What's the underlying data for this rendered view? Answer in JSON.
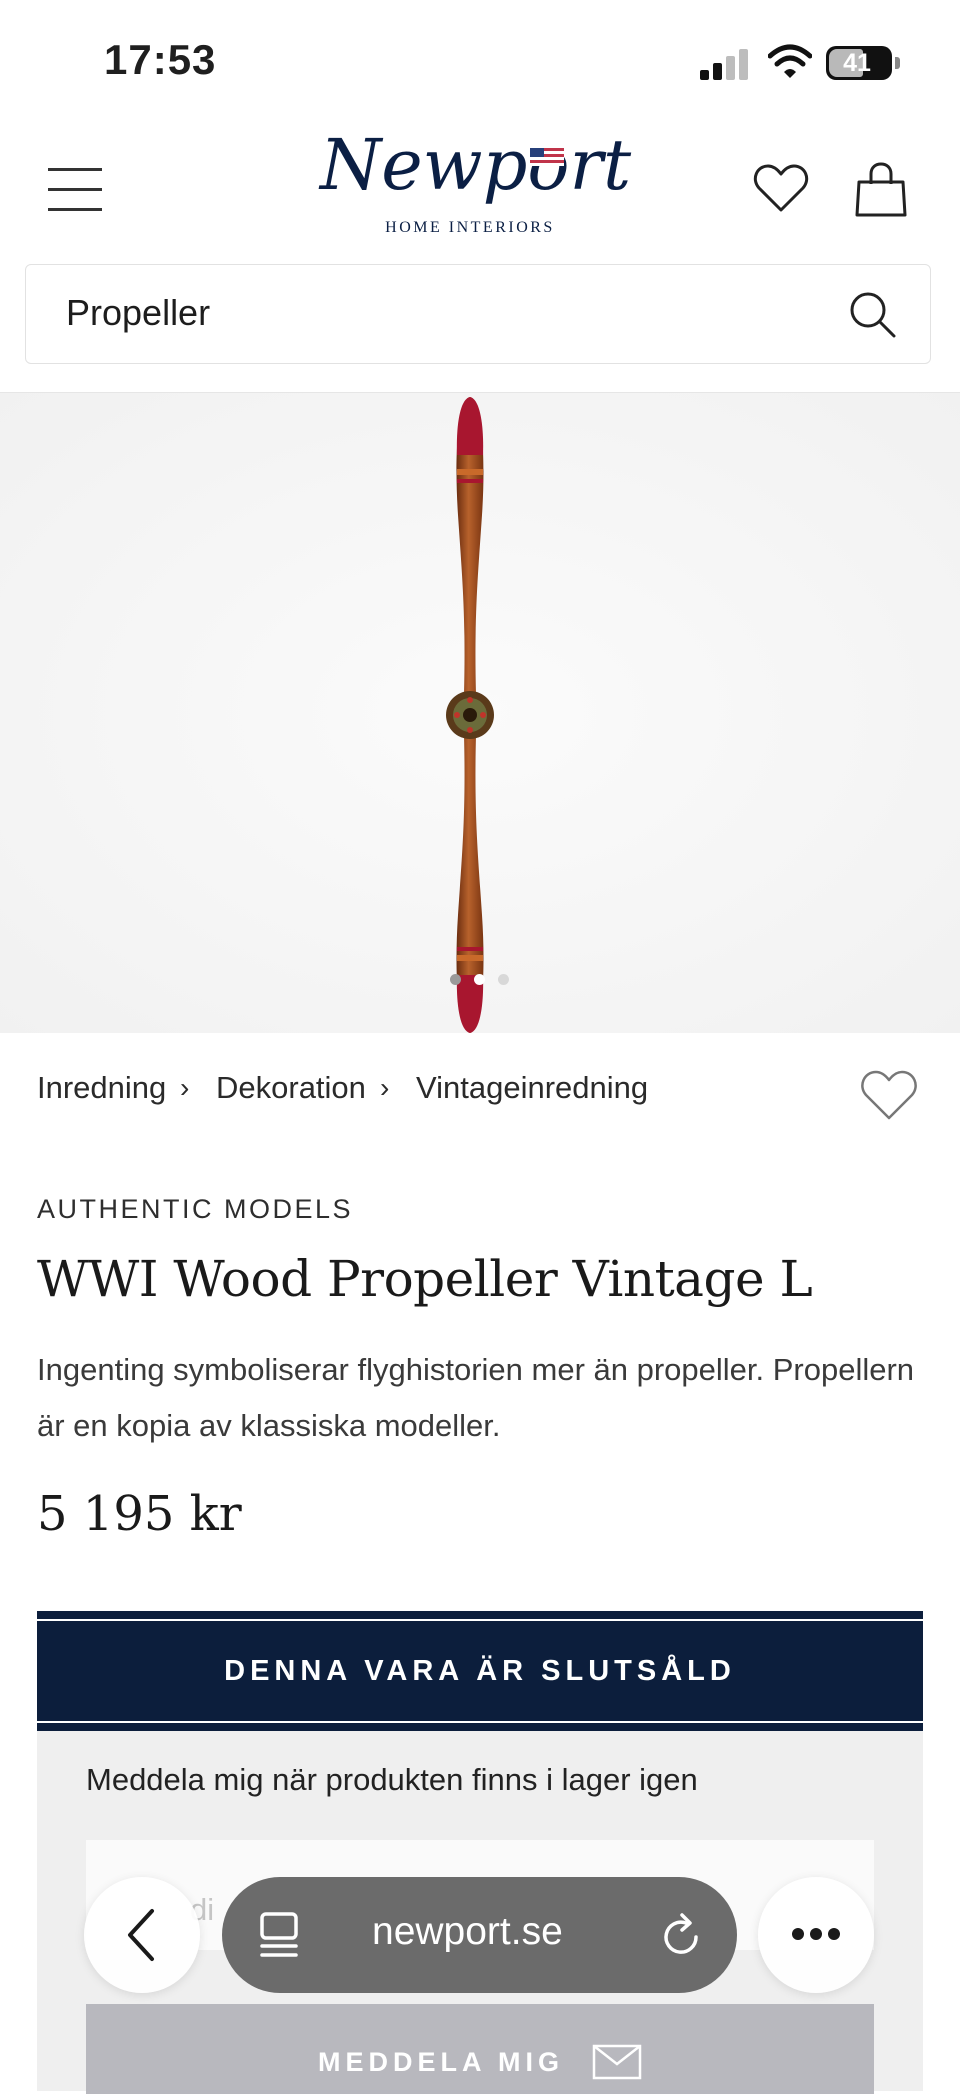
{
  "status_bar": {
    "time": "17:53",
    "battery": "41"
  },
  "header": {
    "logo_word": "Newport",
    "logo_sub": "HOME INTERIORS"
  },
  "search": {
    "value": "Propeller"
  },
  "gallery": {
    "slide_count": 3,
    "active_index": 1
  },
  "breadcrumb": {
    "items": [
      "Inredning",
      "Dekoration",
      "Vintageinredning"
    ],
    "separator": "›"
  },
  "product": {
    "brand": "AUTHENTIC MODELS",
    "title": "WWI Wood Propeller Vintage L",
    "description": "Ingenting symboliserar flyghistorien mer än propeller. Propellern är en kopia av klassiska modeller.",
    "price": "5 195 kr",
    "soldout_label": "DENNA VARA ÄR SLUTSÅLD"
  },
  "notify": {
    "text": "Meddela mig när produkten finns i lager igen",
    "field_placeholder_partial": "di",
    "button_label": "MEDDELA MIG"
  },
  "browser": {
    "url": "newport.se"
  },
  "colors": {
    "navy": "#0c1e3c",
    "propeller_wood": "#9a4a1e",
    "propeller_tip": "#a8162f"
  }
}
